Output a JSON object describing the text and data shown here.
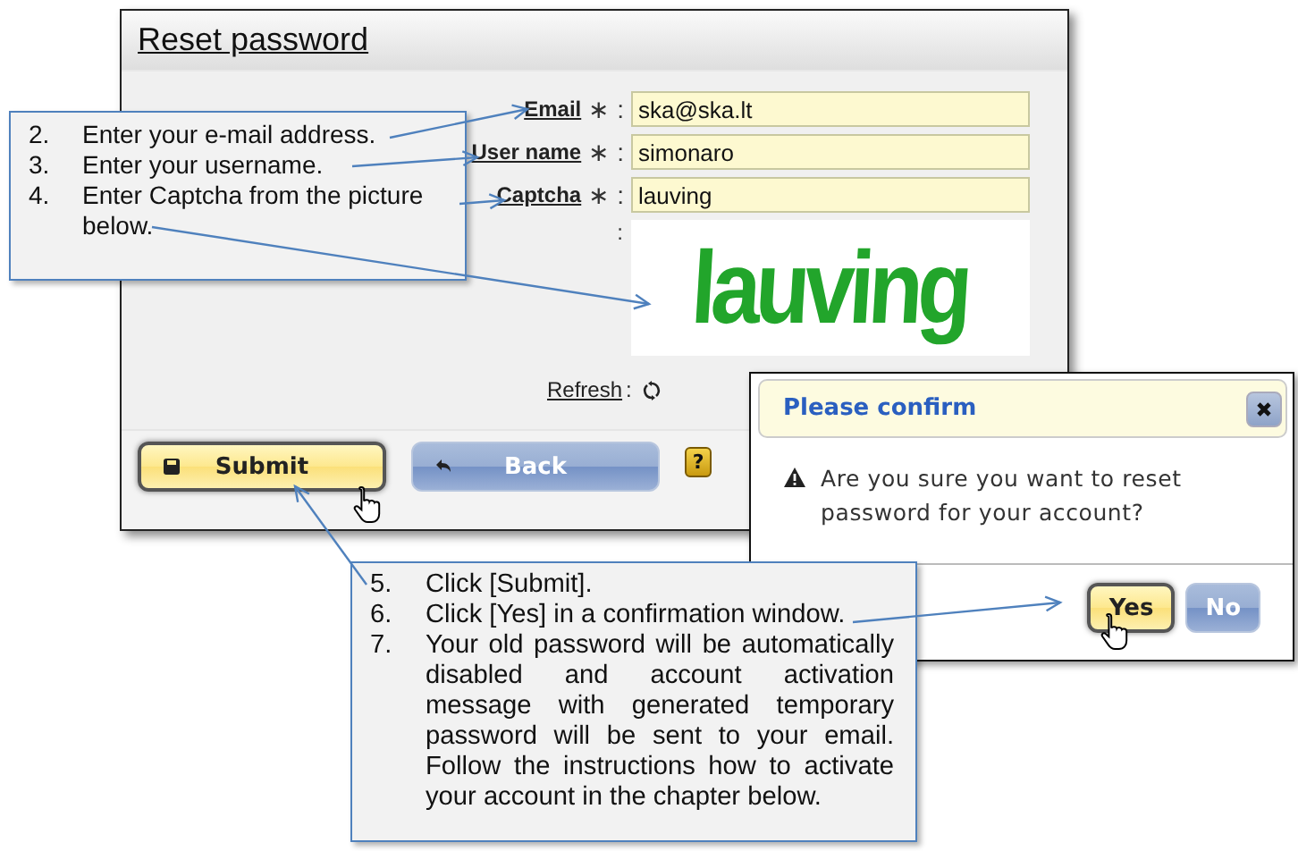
{
  "window": {
    "title": "Reset password"
  },
  "fields": [
    {
      "label": "Email",
      "required_mark": "∗",
      "separator": ":",
      "value": "ska@ska.lt"
    },
    {
      "label": "User name",
      "required_mark": "∗",
      "separator": ":",
      "value": "simonaro"
    },
    {
      "label": "Captcha",
      "required_mark": "∗",
      "separator": ":",
      "value": "lauving"
    }
  ],
  "captcha": {
    "separator": ":",
    "image_text": "lauving"
  },
  "refresh": {
    "label": "Refresh",
    "separator": ":"
  },
  "buttons": [
    {
      "kind": "primary",
      "label": "Submit",
      "hovered": true
    },
    {
      "kind": "secondary",
      "label": "Back",
      "hovered": false
    },
    {
      "kind": "help",
      "label": "?",
      "hovered": false
    }
  ],
  "dialog": {
    "title": "Please confirm",
    "message": "Are you sure you want to reset password for your account?",
    "buttons": [
      {
        "kind": "primary",
        "label": "Yes",
        "hovered": true
      },
      {
        "kind": "secondary",
        "label": "No",
        "hovered": false
      }
    ]
  },
  "callouts": [
    {
      "steps": [
        {
          "number": "2.",
          "text": "Enter your e-mail address."
        },
        {
          "number": "3.",
          "text": "Enter your username."
        },
        {
          "number": "4.",
          "text": "Enter Captcha from the picture below."
        }
      ]
    },
    {
      "steps": [
        {
          "number": "5.",
          "text": "Click [Submit]."
        },
        {
          "number": "6.",
          "text": "Click [Yes] in a confirmation window."
        },
        {
          "number": "7.",
          "text": "Your old password will be automatically disabled and account activation message with generated temporary password will be sent to your email. Follow the instructions how to activate your account in the chapter below."
        }
      ]
    }
  ]
}
